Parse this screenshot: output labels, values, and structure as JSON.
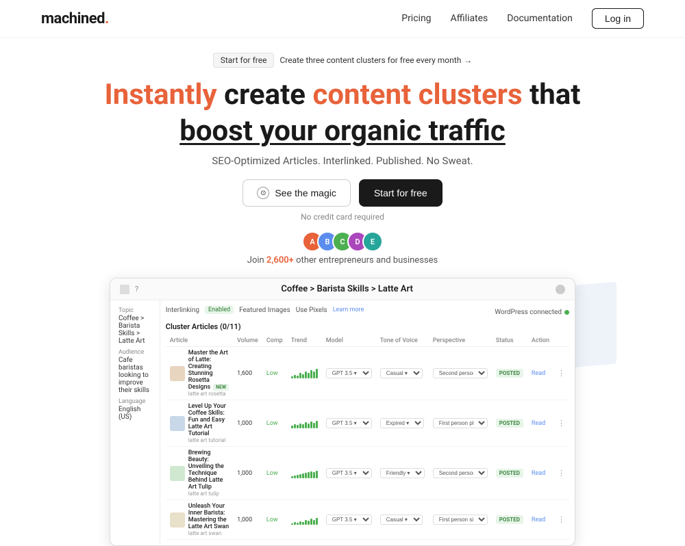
{
  "nav": {
    "logo_text": "machined",
    "logo_dot": ".",
    "links": [
      {
        "label": "Pricing",
        "id": "pricing"
      },
      {
        "label": "Affiliates",
        "id": "affiliates"
      },
      {
        "label": "Documentation",
        "id": "documentation"
      }
    ],
    "login_label": "Log in"
  },
  "banner": {
    "tag": "Start for free",
    "link_text": "Create three content clusters for free every month"
  },
  "hero": {
    "line1_normal": "create",
    "line1_orange1": "Instantly",
    "line1_orange2": "content clusters",
    "line1_end": "that",
    "line2": "boost your organic traffic",
    "sub": "SEO-Optimized Articles. Interlinked. Published. No Sweat.",
    "btn_magic": "See the magic",
    "btn_start": "Start for free",
    "no_credit": "No credit card required",
    "social_count": "2,600+",
    "social_text": "other entrepreneurs and businesses"
  },
  "dashboard": {
    "title": "Coffee > Barista Skills > Latte Art",
    "topic_label": "Topic",
    "topic_value": "Coffee > Barista Skills > Latte Art",
    "audience_label": "Audience",
    "audience_value": "Cafe baristas looking to improve their skills",
    "language_label": "Language",
    "language_value": "English (US)",
    "interlink_label": "Interlinking",
    "interlink_status": "Enabled",
    "featured_images_label": "Featured Images",
    "featured_images_value": "Use Pixels",
    "learn_more": "Learn more",
    "wp_label": "WordPress connected",
    "cluster_header": "Cluster Articles (0/11)",
    "col_article": "Article",
    "col_volume": "Volume",
    "col_comp": "Comp",
    "col_trend": "Trend",
    "col_model": "Model",
    "col_tone": "Tone of Voice",
    "col_perspective": "Perspective",
    "col_status": "Status",
    "col_action": "Action",
    "articles": [
      {
        "title": "Master the Art of Latte: Creating Stunning Rosetta Designs",
        "sub": "latte art rosetta",
        "badge": "NEW",
        "volume": "1,600",
        "comp": "Low",
        "model": "GPT 3.5",
        "tone": "Casual",
        "perspective": "Second person (you, your...",
        "status": "POSTED"
      },
      {
        "title": "Level Up Your Coffee Skills: Fun and Easy Latte Art Tutorial",
        "sub": "latte art tutorial",
        "badge": "",
        "volume": "1,000",
        "comp": "Low",
        "model": "GPT 3.5",
        "tone": "Expired",
        "perspective": "First person plural (we, us...",
        "status": "POSTED"
      },
      {
        "title": "Brewing Beauty: Unveiling the Technique Behind Latte Art Tulip",
        "sub": "latte art tulip",
        "badge": "",
        "volume": "1,000",
        "comp": "Low",
        "model": "GPT 3.5",
        "tone": "Friendly",
        "perspective": "Second person (you, your...",
        "status": "POSTED"
      },
      {
        "title": "Unleash Your Inner Barista: Mastering the Latte Art Swan",
        "sub": "latte art swan",
        "badge": "",
        "volume": "1,000",
        "comp": "Low",
        "model": "GPT 3.5",
        "tone": "Casual",
        "perspective": "First person singular (I, m...",
        "status": "POSTED"
      }
    ]
  },
  "avatars": [
    {
      "color": "#e8623a",
      "initial": "A"
    },
    {
      "color": "#5b8dee",
      "initial": "B"
    },
    {
      "color": "#4caf50",
      "initial": "C"
    },
    {
      "color": "#ab47bc",
      "initial": "D"
    },
    {
      "color": "#26a69a",
      "initial": "E"
    }
  ]
}
